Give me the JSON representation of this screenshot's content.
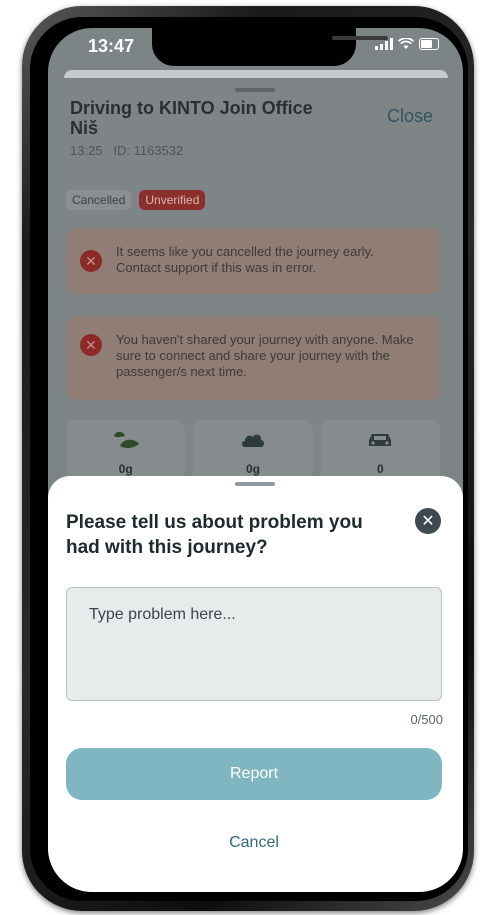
{
  "status_bar": {
    "time": "13:47"
  },
  "journey": {
    "title": "Driving to KINTO Join Office Niš",
    "close_label": "Close",
    "meta": "13:25   ID: 1163532",
    "tags": {
      "cancelled": "Cancelled",
      "unverified": "Unverified"
    },
    "alerts": [
      {
        "text": "It seems like you cancelled the journey early. Contact support if this was in error."
      },
      {
        "text": "You haven't shared your journey with anyone. Make sure to connect and share your journey with the passenger/s next time."
      }
    ],
    "stats": [
      {
        "icon": "leaf-icon",
        "value": "0g"
      },
      {
        "icon": "cloud-icon",
        "value": "0g"
      },
      {
        "icon": "car-icon",
        "value": "0"
      }
    ]
  },
  "report_sheet": {
    "title": "Please tell us about problem you had with this journey?",
    "placeholder": "Type problem here...",
    "char_count": "0/500",
    "report_label": "Report",
    "cancel_label": "Cancel"
  }
}
